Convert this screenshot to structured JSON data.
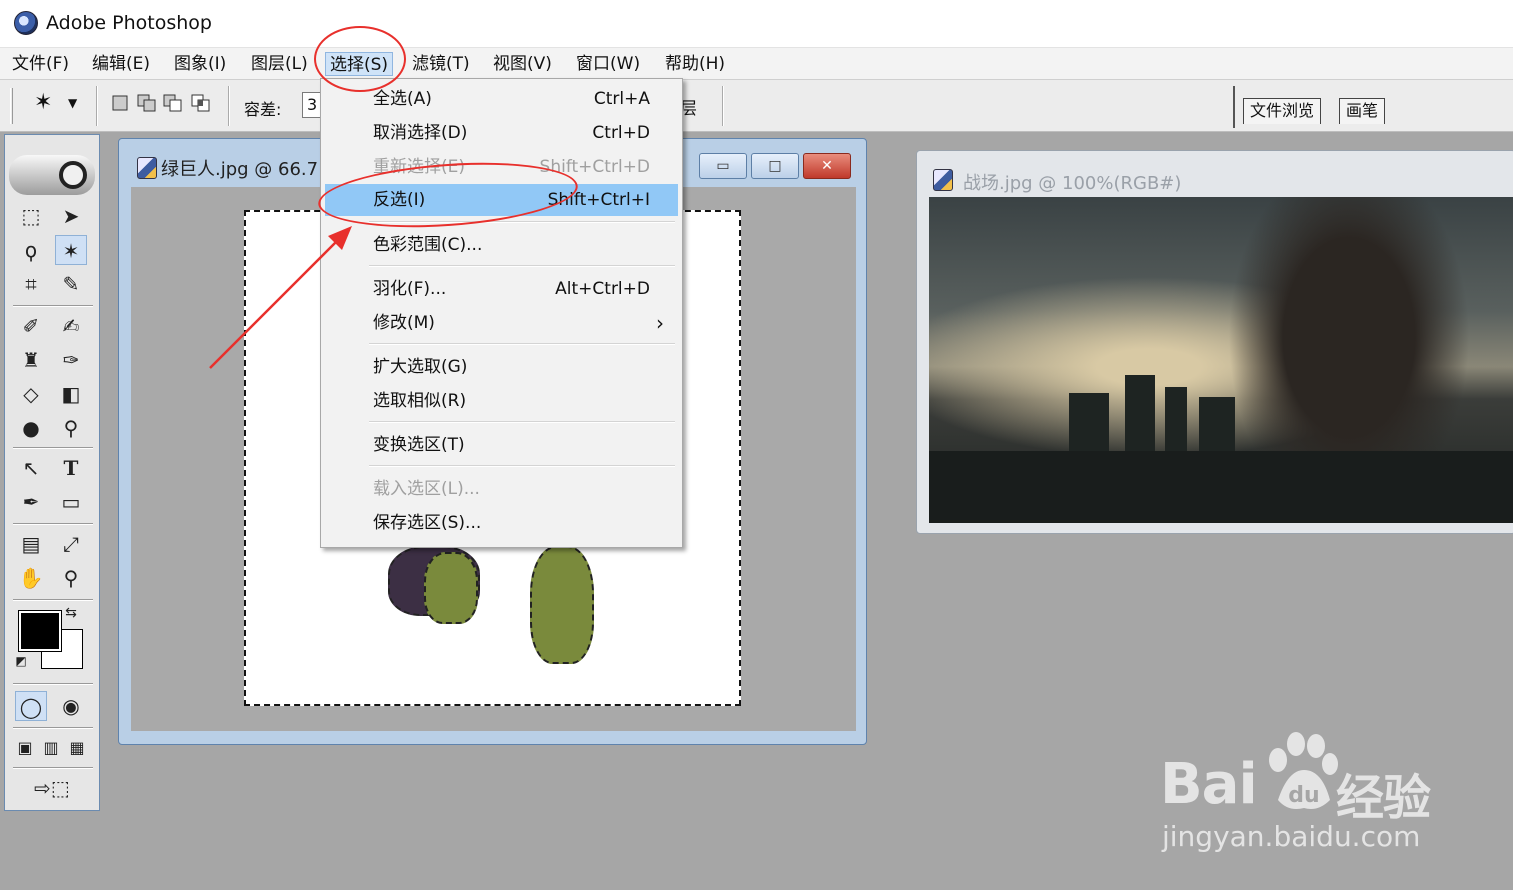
{
  "app": {
    "title": "Adobe Photoshop"
  },
  "menubar": {
    "items": [
      {
        "label": "文件(F)"
      },
      {
        "label": "编辑(E)"
      },
      {
        "label": "图象(I)"
      },
      {
        "label": "图层(L)"
      },
      {
        "label": "选择(S)"
      },
      {
        "label": "滤镜(T)"
      },
      {
        "label": "视图(V)"
      },
      {
        "label": "窗口(W)"
      },
      {
        "label": "帮助(H)"
      }
    ],
    "active": "选择(S)"
  },
  "options_bar": {
    "tolerance_label": "容差:",
    "tolerance_value": "3",
    "layer_fragment": "层"
  },
  "palette_well": {
    "tabs": [
      "文件浏览",
      "画笔"
    ]
  },
  "doc1": {
    "title": "绿巨人.jpg @ 66.7"
  },
  "doc2": {
    "title": "战场.jpg @ 100%(RGB#)"
  },
  "select_menu": {
    "items": [
      {
        "label": "全选(A)",
        "shortcut": "Ctrl+A"
      },
      {
        "label": "取消选择(D)",
        "shortcut": "Ctrl+D"
      },
      {
        "label": "重新选择(E)",
        "shortcut": "Shift+Ctrl+D",
        "disabled": true
      },
      {
        "label": "反选(I)",
        "shortcut": "Shift+Ctrl+I",
        "highlighted": true
      },
      {
        "label": "色彩范围(C)...",
        "shortcut": ""
      },
      {
        "label": "羽化(F)...",
        "shortcut": "Alt+Ctrl+D"
      },
      {
        "label": "修改(M)",
        "shortcut": "›"
      },
      {
        "label": "扩大选取(G)",
        "shortcut": ""
      },
      {
        "label": "选取相似(R)",
        "shortcut": ""
      },
      {
        "label": "变换选区(T)",
        "shortcut": ""
      },
      {
        "label": "载入选区(L)...",
        "shortcut": "",
        "disabled": true
      },
      {
        "label": "保存选区(S)...",
        "shortcut": ""
      }
    ]
  },
  "watermark": {
    "brand": "Bai",
    "brand2": "经验",
    "url": "jingyan.baidu.com"
  },
  "colors": {
    "highlight": "#91c8f6",
    "annotation": "#e8302c",
    "foreground_swatch": "#000000",
    "background_swatch": "#ffffff"
  }
}
